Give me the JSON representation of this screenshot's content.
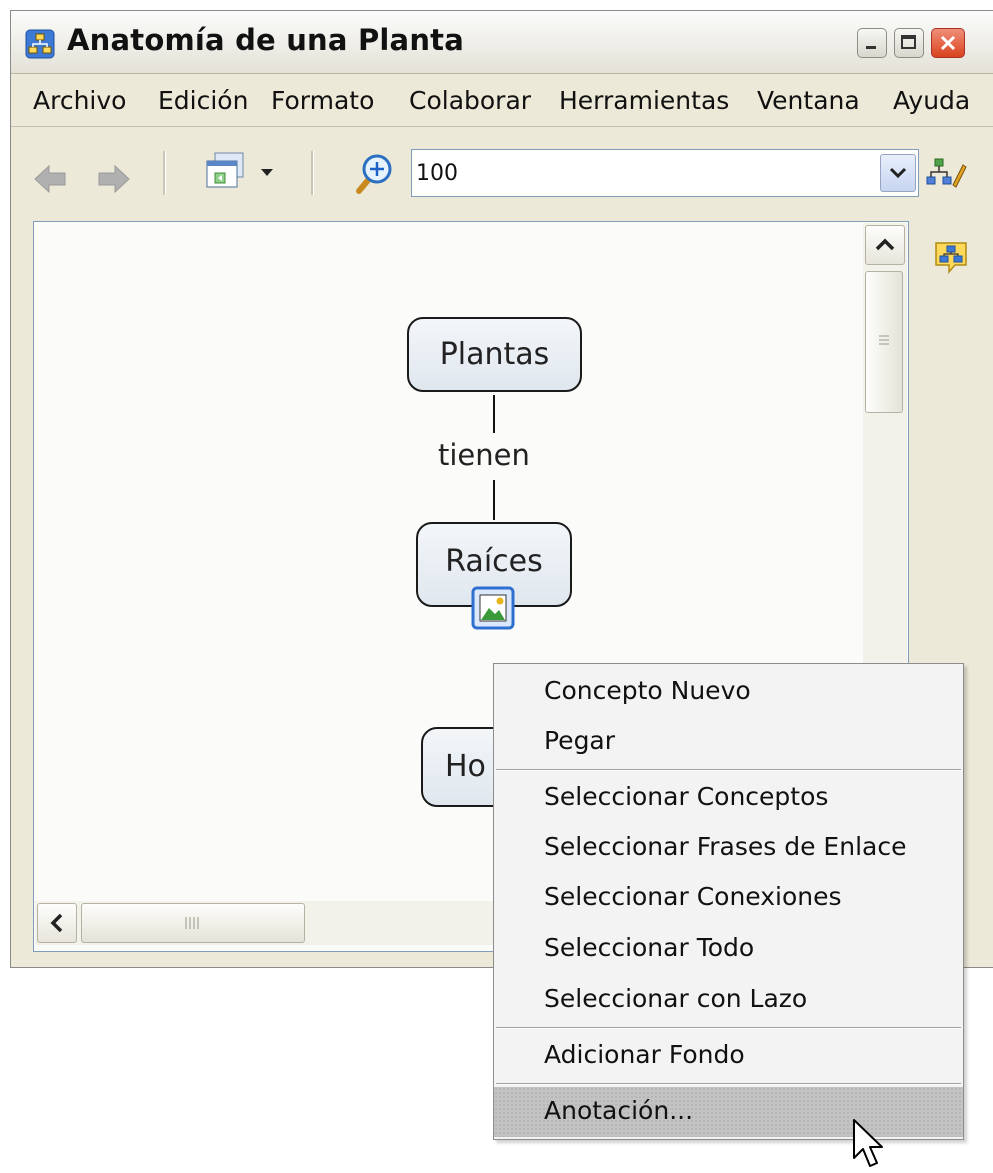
{
  "window": {
    "title": "Anatomía de una Planta"
  },
  "menubar": {
    "items": [
      "Archivo",
      "Edición",
      "Formato",
      "Colaborar",
      "Herramientas",
      "Ventana",
      "Ayuda"
    ]
  },
  "toolbar": {
    "zoom_value": "100",
    "icons": [
      "back-arrow-icon",
      "forward-arrow-icon",
      "view-window-icon",
      "zoom-icon",
      "style-palette-icon"
    ]
  },
  "map": {
    "concepts": [
      "Plantas",
      "Raíces",
      "Ho"
    ],
    "link_phrases": [
      "tienen"
    ]
  },
  "context_menu": {
    "groups": [
      [
        "Concepto Nuevo",
        "Pegar"
      ],
      [
        "Seleccionar Conceptos",
        "Seleccionar Frases de Enlace",
        "Seleccionar Conexiones",
        "Seleccionar Todo",
        "Seleccionar con Lazo"
      ],
      [
        "Adicionar Fondo"
      ],
      [
        "Anotación..."
      ]
    ],
    "highlighted": "Anotación..."
  },
  "colors": {
    "window_bg": "#ece9d8",
    "accent": "#1c62c4",
    "close_button": "#d9431e",
    "highlight": "#c3c3c3"
  }
}
